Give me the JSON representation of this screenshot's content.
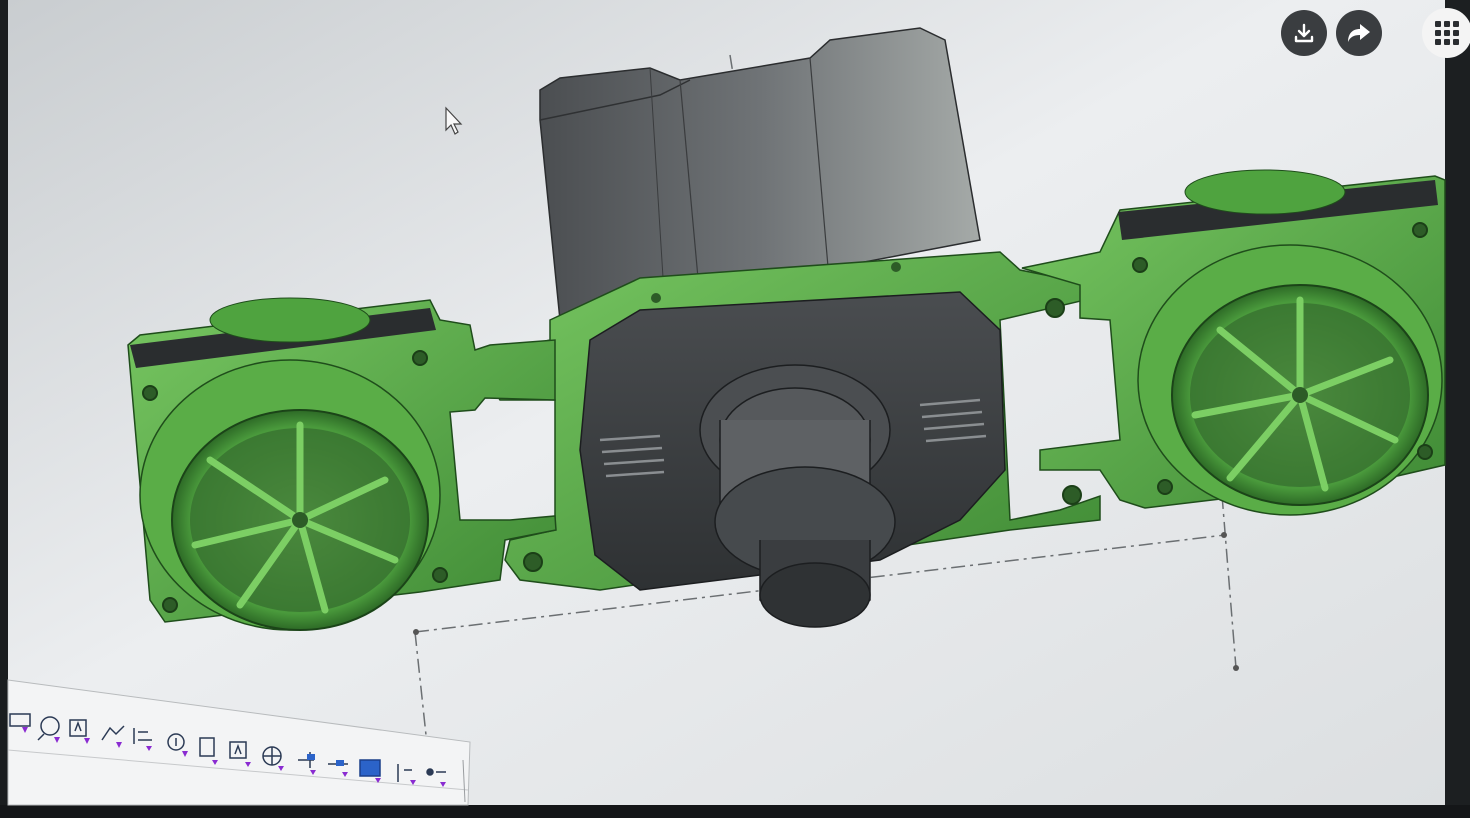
{
  "overlay": {
    "download_icon": "download-icon",
    "share_icon": "share-icon",
    "apps_icon": "grid-apps-icon"
  },
  "colors": {
    "part_green": "#5fb04a",
    "part_green_dark": "#2e6e2a",
    "motor_gray": "#3d4043",
    "viewport_bg": "#e6e8ea",
    "bezel": "#1a1d1f"
  },
  "toolbar": {
    "icons": [
      "view-toggle-icon",
      "normal-icon",
      "text-icon",
      "sketch-icon",
      "hatch-icon",
      "zoom-icon",
      "section-icon",
      "annotation-icon",
      "center-mark-icon",
      "datum-icon",
      "datum-axis-icon",
      "image-icon",
      "symbol-icon",
      "point-icon"
    ]
  }
}
